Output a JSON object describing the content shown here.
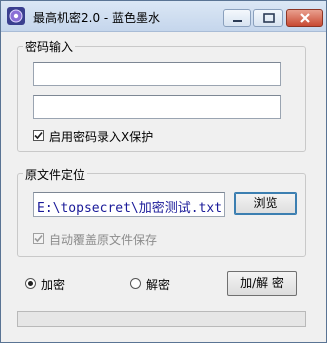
{
  "window": {
    "title": "最高机密2.0 - 蓝色墨水",
    "icons": {
      "app": "lock-app-icon",
      "minimize": "minimize-icon",
      "maximize": "maximize-icon",
      "close": "close-icon"
    }
  },
  "password_group": {
    "legend": "密码输入",
    "field1_value": "",
    "field2_value": "",
    "protect_checkbox": {
      "label": "启用密码录入X保护",
      "checked": true
    }
  },
  "file_group": {
    "legend": "原文件定位",
    "path_value": "E:\\topsecret\\加密测试.txt",
    "browse_label": "浏览",
    "overwrite_checkbox": {
      "label": "自动覆盖原文件保存",
      "checked": true,
      "disabled": true
    }
  },
  "mode": {
    "encrypt_label": "加密",
    "decrypt_label": "解密",
    "selected": "encrypt",
    "action_label": "加/解 密"
  },
  "progress": {
    "value": 0
  },
  "colors": {
    "path_text": "#1a1a99",
    "title_bar": "#c5d6ec"
  }
}
